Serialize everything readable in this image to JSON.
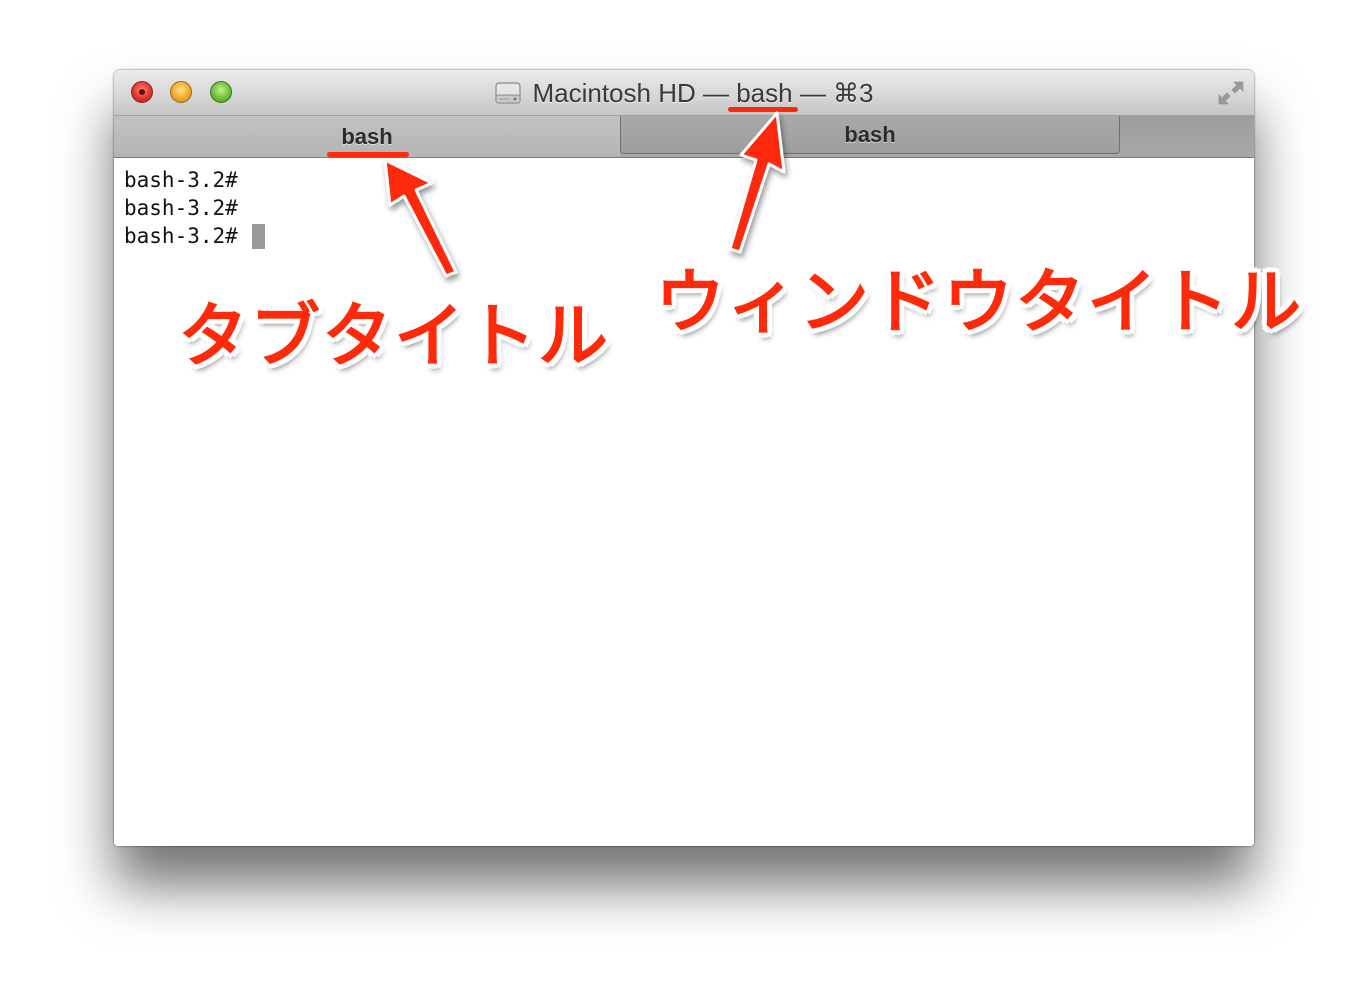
{
  "window": {
    "title_prefix": "Macintosh HD — ",
    "title_process": "bash",
    "title_suffix": " — ⌘3",
    "disk_icon": "hard-disk-icon",
    "fullscreen_icon": "fullscreen-arrows-icon"
  },
  "tabs": [
    {
      "label": "bash",
      "state": "active"
    },
    {
      "label": "bash",
      "state": "inactive"
    }
  ],
  "terminal": {
    "lines": [
      "bash-3.2#",
      "bash-3.2#",
      "bash-3.2#"
    ]
  },
  "annotations": {
    "tab_title": "タブタイトル",
    "window_title": "ウィンドウタイトル",
    "accent_color": "#ff2a0a"
  }
}
